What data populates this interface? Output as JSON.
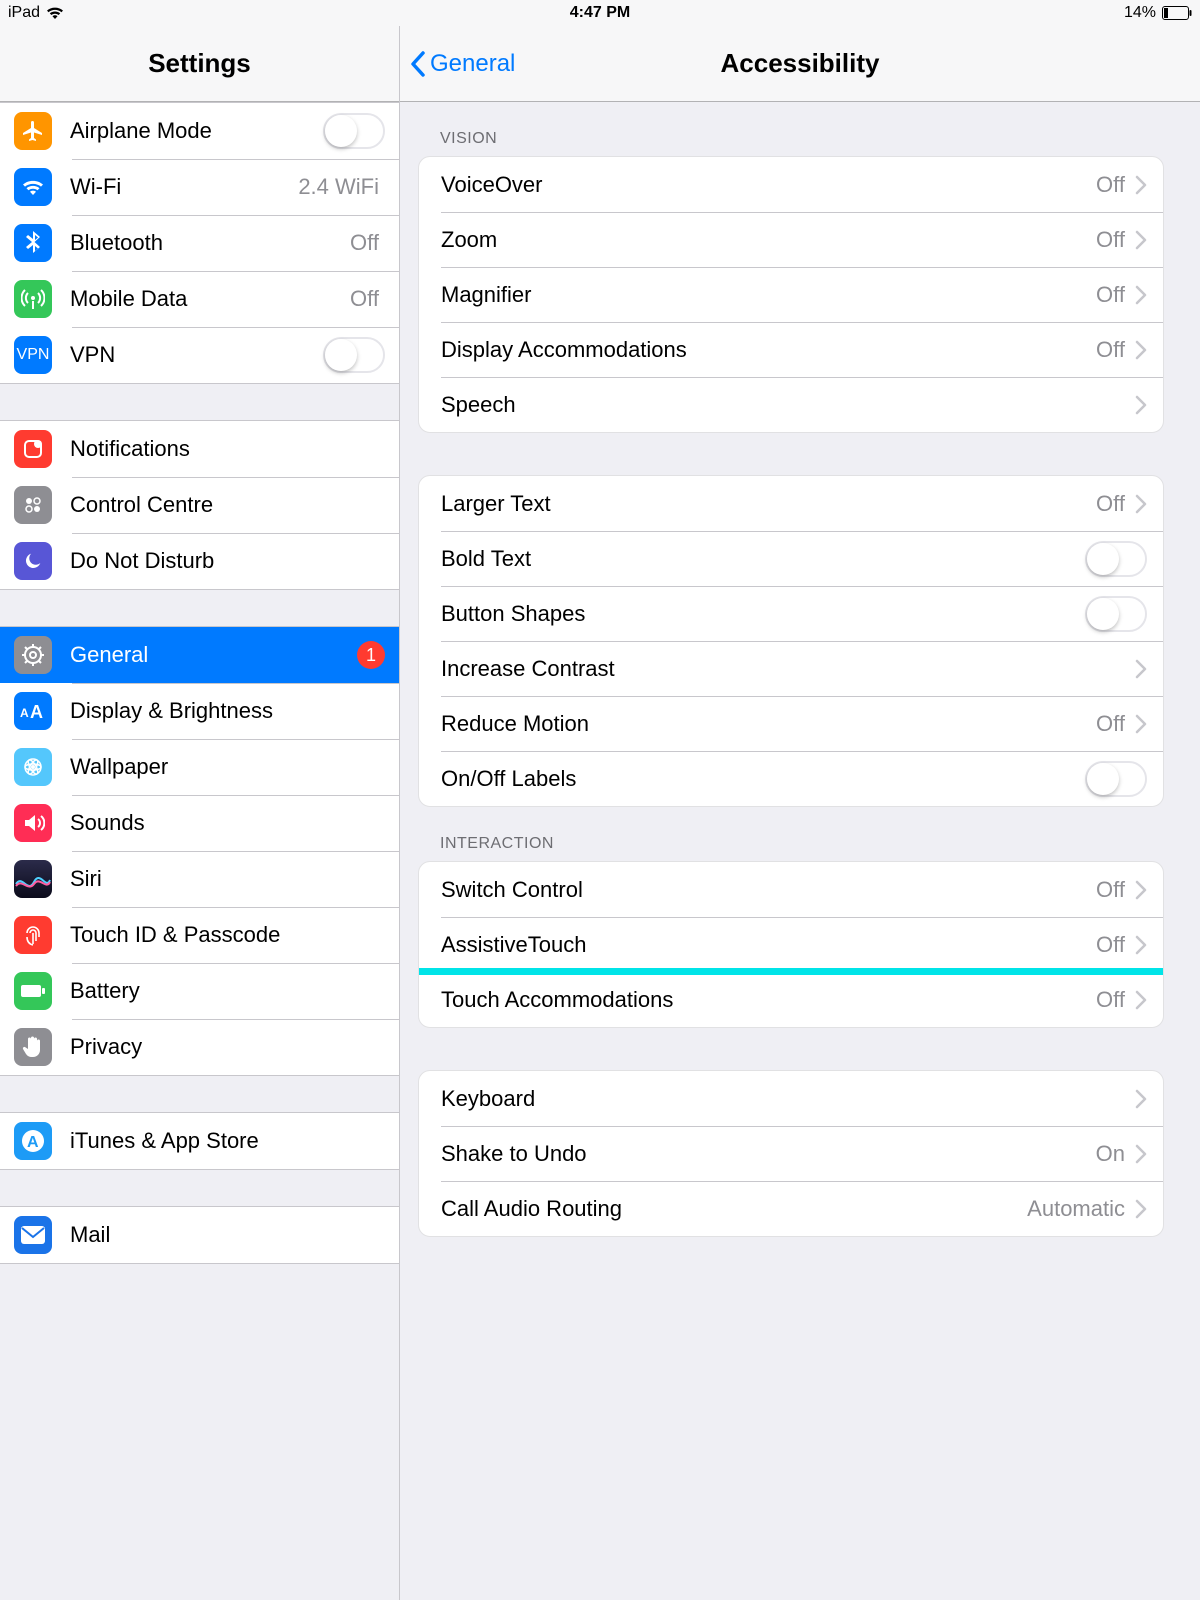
{
  "statusbar": {
    "device": "iPad",
    "time": "4:47 PM",
    "battery_text": "14%"
  },
  "sidebar": {
    "title": "Settings",
    "groups": [
      [
        {
          "id": "airplane",
          "icon": "airplane-icon",
          "bg": "bg-orange",
          "label": "Airplane Mode",
          "accessory": "toggle",
          "toggle_on": false
        },
        {
          "id": "wifi",
          "icon": "wifi-icon",
          "bg": "bg-blue",
          "label": "Wi-Fi",
          "accessory": "value",
          "value": "2.4 WiFi"
        },
        {
          "id": "bluetooth",
          "icon": "bluetooth-icon",
          "bg": "bg-btblue",
          "label": "Bluetooth",
          "accessory": "value",
          "value": "Off"
        },
        {
          "id": "mobiledata",
          "icon": "antenna-icon",
          "bg": "bg-green",
          "label": "Mobile Data",
          "accessory": "value",
          "value": "Off"
        },
        {
          "id": "vpn",
          "icon": "vpn-icon",
          "bg": "bg-vpn",
          "label": "VPN",
          "accessory": "toggle",
          "toggle_on": false
        }
      ],
      [
        {
          "id": "notifications",
          "icon": "notifications-icon",
          "bg": "bg-red",
          "label": "Notifications"
        },
        {
          "id": "controlcentre",
          "icon": "control-centre-icon",
          "bg": "bg-grey",
          "label": "Control Centre"
        },
        {
          "id": "dnd",
          "icon": "moon-icon",
          "bg": "bg-purple",
          "label": "Do Not Disturb"
        }
      ],
      [
        {
          "id": "general",
          "icon": "gear-icon",
          "bg": "bg-grey",
          "label": "General",
          "accessory": "badge",
          "badge": "1",
          "selected": true
        },
        {
          "id": "display",
          "icon": "text-size-icon",
          "bg": "bg-textblue",
          "label": "Display & Brightness"
        },
        {
          "id": "wallpaper",
          "icon": "wallpaper-icon",
          "bg": "bg-cyan",
          "label": "Wallpaper"
        },
        {
          "id": "sounds",
          "icon": "sounds-icon",
          "bg": "bg-pink",
          "label": "Sounds"
        },
        {
          "id": "siri",
          "icon": "siri-icon",
          "bg": "bg-grey",
          "label": "Siri"
        },
        {
          "id": "touchid",
          "icon": "fingerprint-icon",
          "bg": "bg-red",
          "label": "Touch ID & Passcode"
        },
        {
          "id": "battery",
          "icon": "battery-icon",
          "bg": "bg-batt",
          "label": "Battery"
        },
        {
          "id": "privacy",
          "icon": "hand-icon",
          "bg": "bg-hand",
          "label": "Privacy"
        }
      ],
      [
        {
          "id": "appstore",
          "icon": "appstore-icon",
          "bg": "bg-appstore",
          "label": "iTunes & App Store"
        }
      ],
      [
        {
          "id": "mail",
          "icon": "mail-icon",
          "bg": "bg-mail",
          "label": "Mail"
        }
      ]
    ]
  },
  "detail": {
    "back_label": "General",
    "title": "Accessibility",
    "sections": [
      {
        "header": "Vision",
        "rows": [
          {
            "label": "VoiceOver",
            "accessory": "value-chevron",
            "value": "Off"
          },
          {
            "label": "Zoom",
            "accessory": "value-chevron",
            "value": "Off"
          },
          {
            "label": "Magnifier",
            "accessory": "value-chevron",
            "value": "Off"
          },
          {
            "label": "Display Accommodations",
            "accessory": "value-chevron",
            "value": "Off"
          },
          {
            "label": "Speech",
            "accessory": "chevron"
          }
        ]
      },
      {
        "rows": [
          {
            "label": "Larger Text",
            "accessory": "value-chevron",
            "value": "Off"
          },
          {
            "label": "Bold Text",
            "accessory": "toggle",
            "toggle_on": false
          },
          {
            "label": "Button Shapes",
            "accessory": "toggle",
            "toggle_on": false
          },
          {
            "label": "Increase Contrast",
            "accessory": "chevron"
          },
          {
            "label": "Reduce Motion",
            "accessory": "value-chevron",
            "value": "Off"
          },
          {
            "label": "On/Off Labels",
            "accessory": "toggle",
            "toggle_on": false
          }
        ]
      },
      {
        "header": "Interaction",
        "rows": [
          {
            "label": "Switch Control",
            "accessory": "value-chevron",
            "value": "Off"
          },
          {
            "label": "AssistiveTouch",
            "accessory": "value-chevron",
            "value": "Off",
            "highlight": true
          },
          {
            "label": "Touch Accommodations",
            "accessory": "value-chevron",
            "value": "Off"
          }
        ]
      },
      {
        "rows": [
          {
            "label": "Keyboard",
            "accessory": "chevron"
          },
          {
            "label": "Shake to Undo",
            "accessory": "value-chevron",
            "value": "On"
          },
          {
            "label": "Call Audio Routing",
            "accessory": "value-chevron",
            "value": "Automatic"
          }
        ]
      }
    ]
  }
}
